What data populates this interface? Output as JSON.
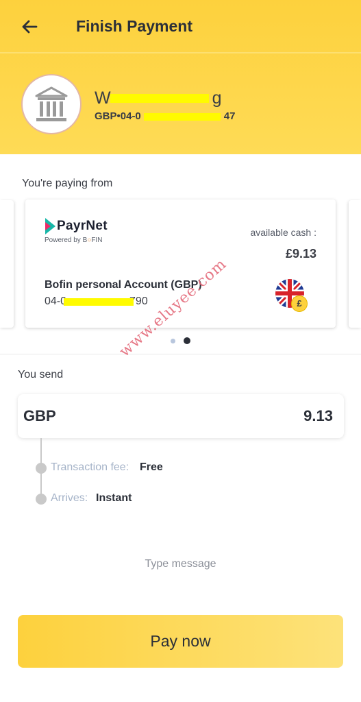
{
  "header": {
    "title": "Finish Payment",
    "back_icon": "arrow-left-icon"
  },
  "recipient": {
    "avatar_icon": "bank-icon",
    "name_start": "W",
    "name_end": "g",
    "account_prefix": "GBP•04-0",
    "account_suffix": "47"
  },
  "source": {
    "section_label": "You're paying from",
    "provider_name": "PayrNet",
    "provider_powered": "Powered by B",
    "provider_powered_brand": "FIN",
    "available_label": "available cash :",
    "available_amount": "£9.13",
    "account_name": "Bofin personal Account (GBP)",
    "account_prefix": "04-0",
    "account_suffix": "790",
    "flag_icon": "uk-flag-icon",
    "currency_badge": "£",
    "carousel_active_index": 2,
    "carousel_total": 2
  },
  "send": {
    "section_label": "You send",
    "currency": "GBP",
    "amount": "9.13",
    "fee_label": "Transaction fee:",
    "fee_value": "Free",
    "arrives_label": "Arrives:",
    "arrives_value": "Instant"
  },
  "message": {
    "placeholder": "Type message"
  },
  "actions": {
    "pay_label": "Pay now"
  },
  "watermark": "www.eluyee.com",
  "colors": {
    "accent": "#fdd13d",
    "text": "#2b2f38",
    "muted_label": "#a5b3c8"
  }
}
